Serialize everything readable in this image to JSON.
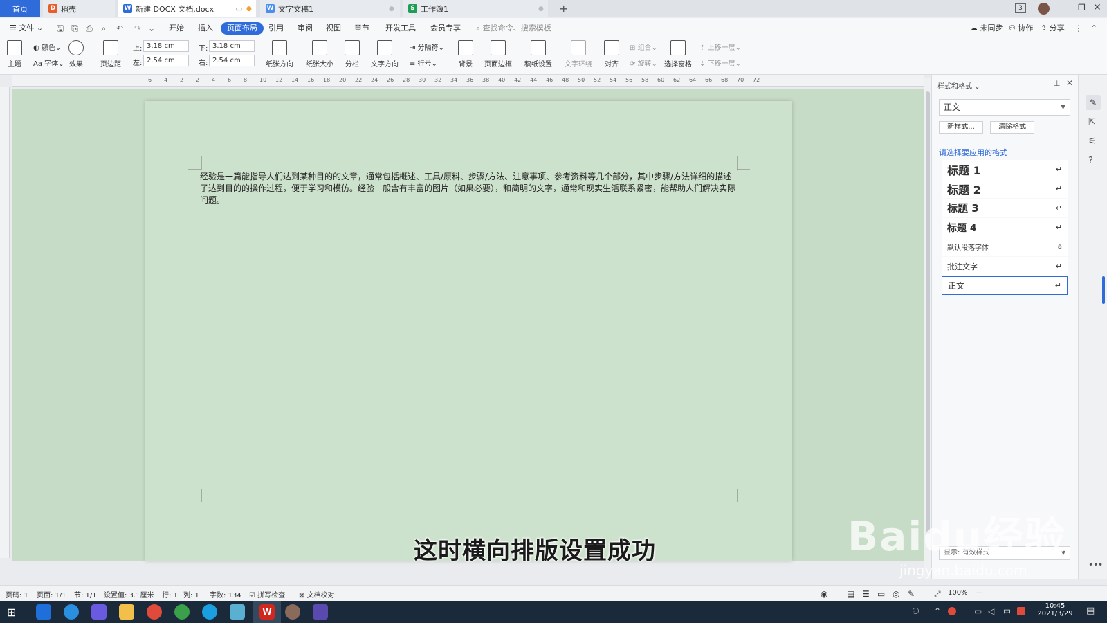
{
  "tabs": {
    "home": "首页",
    "daoke": "稻壳",
    "doc1": "新建 DOCX 文档.docx",
    "doc2": "文字文稿1",
    "sheet": "工作簿1",
    "new_tab": "+",
    "badge": "3"
  },
  "menu": {
    "file": "文件",
    "items": [
      "开始",
      "插入",
      "页面布局",
      "引用",
      "审阅",
      "视图",
      "章节",
      "开发工具",
      "会员专享"
    ],
    "search_placeholder": "查找命令、搜索模板",
    "sync": "未同步",
    "collab": "协作",
    "share": "分享"
  },
  "ribbon": {
    "theme": "主题",
    "color": "颜色",
    "font": "字体",
    "effect": "效果",
    "margins": "页边距",
    "top_label": "上:",
    "top_value": "3.18 cm",
    "bottom_label": "下:",
    "bottom_value": "3.18 cm",
    "left_label": "左:",
    "left_value": "2.54 cm",
    "right_label": "右:",
    "right_value": "2.54 cm",
    "orientation": "纸张方向",
    "size": "纸张大小",
    "columns": "分栏",
    "text_direction": "文字方向",
    "breaks": "分隔符",
    "line_numbers": "行号",
    "background": "背景",
    "page_border": "页面边框",
    "grid_settings": "稿纸设置",
    "wrap_text": "文字环绕",
    "align": "对齐",
    "group": "组合",
    "rotate": "旋转",
    "selection_pane": "选择窗格",
    "bring_forward": "上移一层",
    "send_backward": "下移一层"
  },
  "ruler_ticks": [
    "6",
    "4",
    "2",
    "2",
    "4",
    "6",
    "8",
    "10",
    "12",
    "14",
    "16",
    "18",
    "20",
    "22",
    "24",
    "26",
    "28",
    "30",
    "32",
    "34",
    "36",
    "38",
    "40",
    "42",
    "44",
    "46",
    "48",
    "50",
    "52",
    "54",
    "56",
    "58",
    "60",
    "62",
    "64",
    "66",
    "68",
    "70",
    "72"
  ],
  "document": {
    "paragraph": "经验是一篇能指导人们达到某种目的的文章，通常包括概述、工具/原料、步骤/方法、注意事项、参考资料等几个部分，其中步骤/方法详细的描述了达到目的的操作过程，便于学习和模仿。经验一般含有丰富的图片（如果必要），和简明的文字，通常和现实生活联系紧密，能帮助人们解决实际问题。"
  },
  "subtitle": "这时横向排版设置成功",
  "style_panel": {
    "title": "样式和格式",
    "current_style": "正文",
    "new_style": "新样式...",
    "clear_format": "清除格式",
    "prompt": "请选择要应用的格式",
    "styles": [
      "标题 1",
      "标题 2",
      "标题 3",
      "标题 4",
      "默认段落字体",
      "批注文字",
      "正文"
    ],
    "show_label": "显示",
    "show_value": "有效样式"
  },
  "status": {
    "page_num": "页码: 1",
    "pages": "页面: 1/1",
    "section": "节: 1/1",
    "position": "设置值: 3.1厘米",
    "row": "行: 1",
    "col": "列: 1",
    "word_count": "字数: 134",
    "spell_check": "拼写检查",
    "doc_check": "文档校对",
    "zoom": "100%"
  },
  "taskbar": {
    "time": "10:45",
    "date": "2021/3/29",
    "ime": "中"
  },
  "watermark": {
    "brand": "Baidu经验",
    "url": "jingyan.baidu.com"
  },
  "colors": {
    "accent": "#2f6bd9",
    "doc_bg": "#c7dcc6",
    "page_bg": "#cde2cc"
  }
}
